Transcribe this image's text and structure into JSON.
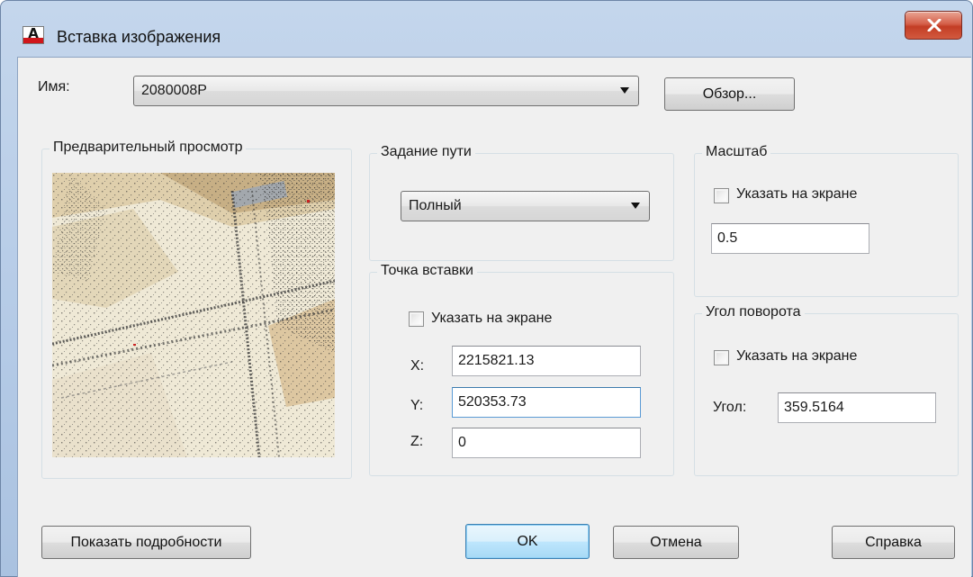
{
  "window": {
    "title": "Вставка изображения",
    "close_glyph": "X"
  },
  "name_row": {
    "label": "Имя:",
    "value": "2080008P",
    "browse_label": "Обзор..."
  },
  "preview": {
    "title": "Предварительный просмотр"
  },
  "path_group": {
    "title": "Задание пути",
    "value": "Полный"
  },
  "insertion_point": {
    "title": "Точка вставки",
    "specify_label": "Указать на экране",
    "x_label": "X:",
    "x_value": "2215821.13",
    "y_label": "Y:",
    "y_value": "520353.73",
    "z_label": "Z:",
    "z_value": "0"
  },
  "scale": {
    "title": "Масштаб",
    "specify_label": "Указать на экране",
    "value": "0.5"
  },
  "rotation": {
    "title": "Угол поворота",
    "specify_label": "Указать на экране",
    "angle_label": "Угол:",
    "angle_value": "359.5164"
  },
  "buttons": {
    "details": "Показать подробности",
    "ok": "OK",
    "cancel": "Отмена",
    "help": "Справка"
  },
  "colors": {
    "title_bar": "#c4d6ec",
    "dialog_bg": "#f0f0f0",
    "close_red": "#c33d25",
    "default_button": "#bee6fd"
  }
}
